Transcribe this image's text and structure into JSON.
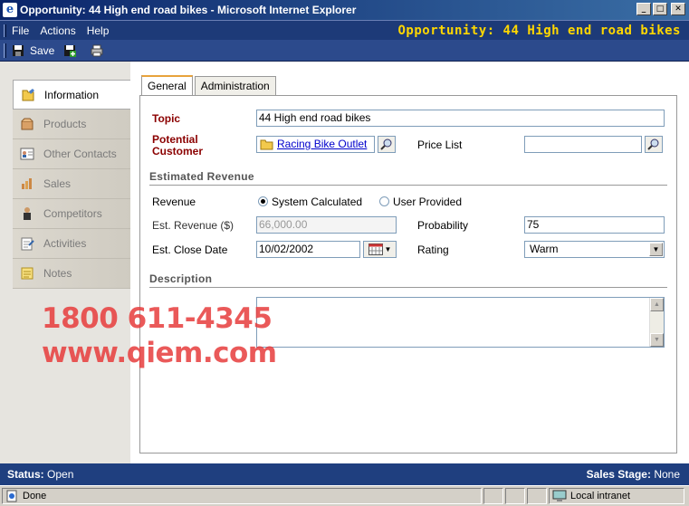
{
  "window": {
    "title": "Opportunity: 44 High end road bikes - Microsoft Internet Explorer",
    "record_title": "Opportunity: 44 High end road bikes"
  },
  "menu": {
    "items": [
      "File",
      "Actions",
      "Help"
    ]
  },
  "toolbar": {
    "save_label": "Save"
  },
  "nav": {
    "items": [
      {
        "label": "Information",
        "icon": "information-icon"
      },
      {
        "label": "Products",
        "icon": "products-icon"
      },
      {
        "label": "Other Contacts",
        "icon": "contacts-icon"
      },
      {
        "label": "Sales",
        "icon": "sales-icon"
      },
      {
        "label": "Competitors",
        "icon": "competitors-icon"
      },
      {
        "label": "Activities",
        "icon": "activities-icon"
      },
      {
        "label": "Notes",
        "icon": "notes-icon"
      }
    ]
  },
  "tabs": [
    "General",
    "Administration"
  ],
  "form": {
    "topic_label": "Topic",
    "topic_value": "44 High end road bikes",
    "potential_customer_label_1": "Potential",
    "potential_customer_label_2": "Customer",
    "potential_customer_value": "Racing Bike Outlet",
    "price_list_label": "Price List",
    "price_list_value": "",
    "estimated_revenue_section": "Estimated Revenue",
    "revenue_label": "Revenue",
    "revenue_option_system": "System Calculated",
    "revenue_option_user": "User Provided",
    "est_revenue_label": "Est. Revenue ($)",
    "est_revenue_value": "66,000.00",
    "probability_label": "Probability",
    "probability_value": "75",
    "est_close_date_label": "Est. Close Date",
    "est_close_date_value": "10/02/2002",
    "rating_label": "Rating",
    "rating_value": "Warm",
    "description_section": "Description",
    "description_value": ""
  },
  "watermark": {
    "line1": "1800 611-4345",
    "line2": "www.qiem.com"
  },
  "status": {
    "status_label": "Status:",
    "status_value": "Open",
    "sales_stage_label": "Sales Stage:",
    "sales_stage_value": "None"
  },
  "ie_status": {
    "text": "Done",
    "zone": "Local intranet"
  }
}
